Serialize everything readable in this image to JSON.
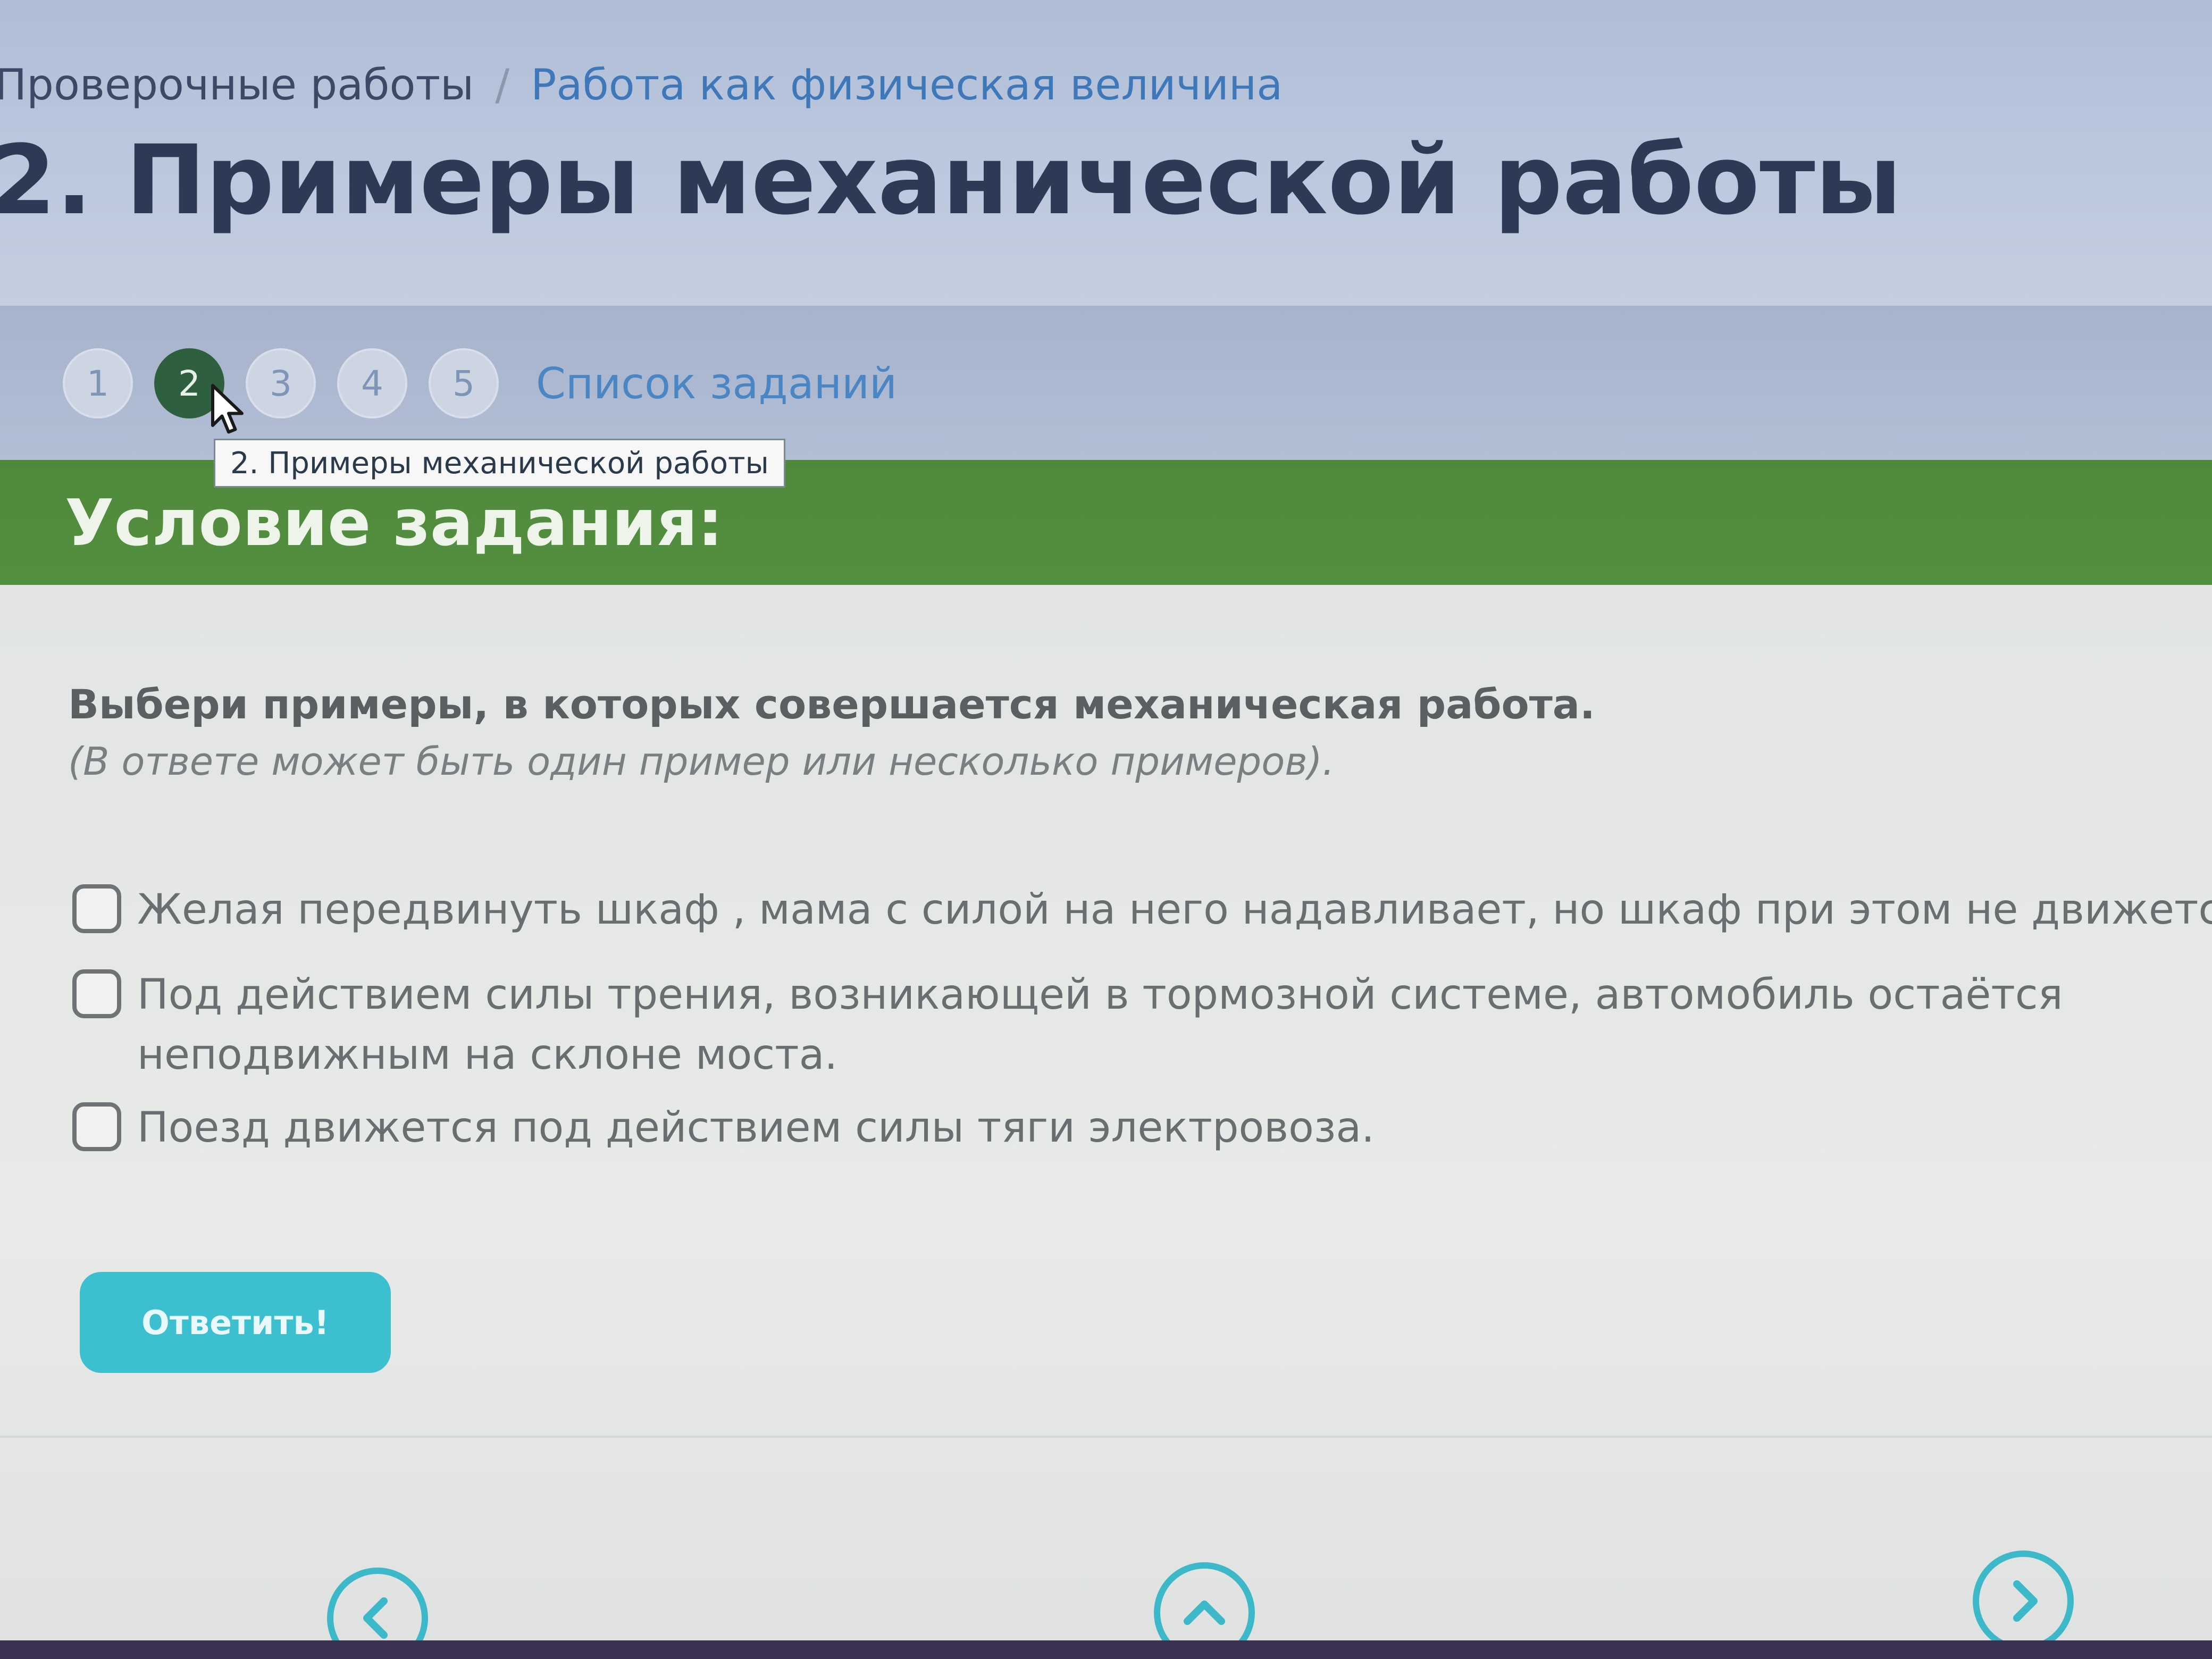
{
  "breadcrumb": {
    "parent": "Проверочные работы",
    "separator": "/",
    "current": "Работа как физическая величина"
  },
  "page_title": "2. Примеры механической работы",
  "stepper": {
    "steps": [
      "1",
      "2",
      "3",
      "4",
      "5"
    ],
    "active_step": "2",
    "task_list_label": "Список заданий",
    "tooltip": "2. Примеры механической работы"
  },
  "condition": {
    "title": "Условие задания:",
    "question": "Выбери примеры, в которых совершается механическая работа.",
    "hint": "(В ответе может быть один пример или несколько примеров)."
  },
  "options": [
    {
      "text": "Желая передвинуть шкаф , мама с силой на него надавливает, но шкаф при этом не движется.",
      "checked": false
    },
    {
      "text": "Под действием силы трения, возникающей в тормозной системе, автомобиль остаётся неподвижным на склоне моста.",
      "checked": false
    },
    {
      "text": "Поезд движется под действием силы тяги электровоза.",
      "checked": false
    }
  ],
  "answer_button": "Ответить!",
  "icons": {
    "cursor": "cursor-arrow-icon",
    "prev": "chevron-left-icon",
    "up": "chevron-up-icon",
    "next": "chevron-right-icon"
  },
  "colors": {
    "header_bg": "#aebcd6",
    "condition_band": "#4f8a3c",
    "active_step": "#2e6040",
    "accent_button": "#3cc0cf",
    "link": "#3f78b8"
  }
}
